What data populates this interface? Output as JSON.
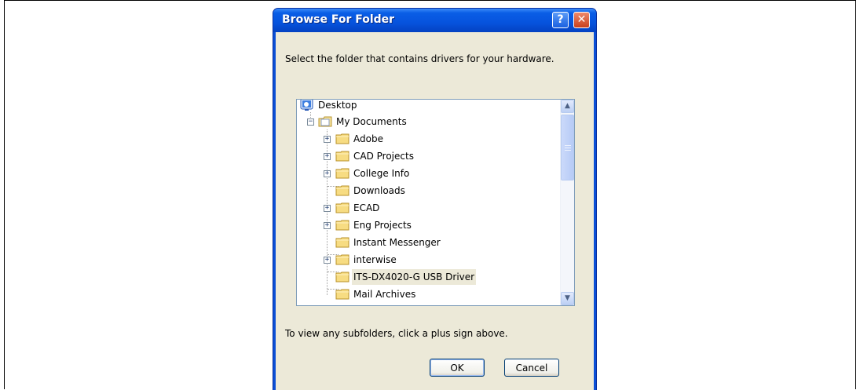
{
  "dialog": {
    "title": "Browse For Folder",
    "help_glyph": "?",
    "close_glyph": "✕",
    "instruction": "Select the folder that contains drivers for your hardware.",
    "hint": "To view any subfolders, click a plus sign above.",
    "ok_label": "OK",
    "cancel_label": "Cancel"
  },
  "tree": {
    "nodes": [
      {
        "label": "Desktop",
        "icon": "desktop-icon"
      },
      {
        "label": "My Documents",
        "icon": "documents-folder-icon",
        "expander": "−"
      },
      {
        "label": "Adobe",
        "icon": "folder-icon",
        "expander": "+"
      },
      {
        "label": "CAD Projects",
        "icon": "folder-icon",
        "expander": "+"
      },
      {
        "label": "College Info",
        "icon": "folder-icon",
        "expander": "+"
      },
      {
        "label": "Downloads",
        "icon": "folder-icon"
      },
      {
        "label": "ECAD",
        "icon": "folder-icon",
        "expander": "+"
      },
      {
        "label": "Eng Projects",
        "icon": "folder-icon",
        "expander": "+"
      },
      {
        "label": "Instant Messenger",
        "icon": "folder-icon"
      },
      {
        "label": "interwise",
        "icon": "folder-icon",
        "expander": "+"
      },
      {
        "label": "ITS-DX4020-G USB Driver",
        "icon": "folder-icon",
        "selected": true
      },
      {
        "label": "Mail Archives",
        "icon": "folder-icon"
      }
    ]
  },
  "scrollbar": {
    "up_glyph": "▲",
    "down_glyph": "▼"
  }
}
